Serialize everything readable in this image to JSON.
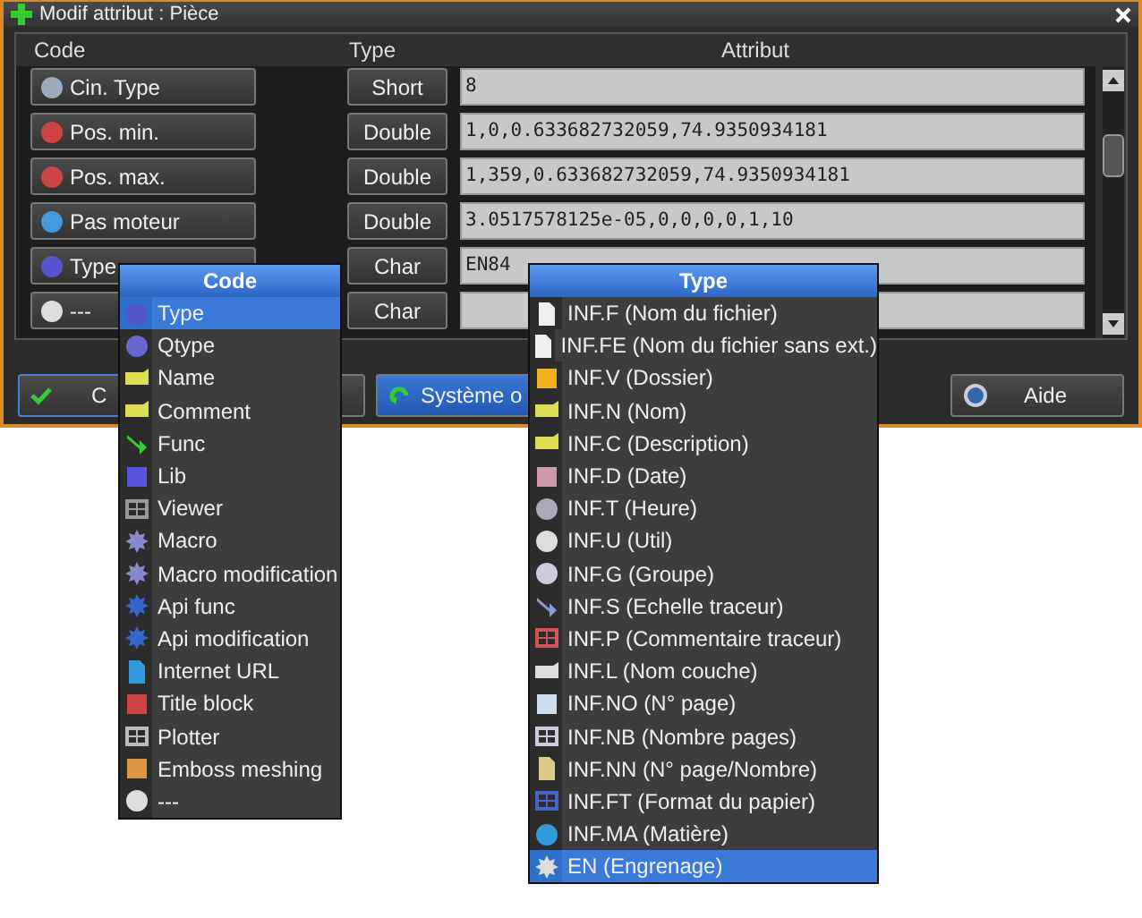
{
  "window": {
    "title": "Modif attribut : Pièce"
  },
  "table": {
    "columns": [
      "Code",
      "Type",
      "Attribut"
    ],
    "rows": [
      {
        "code": "Cin. Type",
        "type": "Short",
        "value": "8"
      },
      {
        "code": "Pos. min.",
        "type": "Double",
        "value": "1,0,0.633682732059,74.9350934181"
      },
      {
        "code": "Pos. max.",
        "type": "Double",
        "value": "1,359,0.633682732059,74.9350934181"
      },
      {
        "code": "Pas moteur",
        "type": "Double",
        "value": "3.0517578125e-05,0,0,0,0,1,10"
      },
      {
        "code": "Type",
        "type": "Char",
        "value": "EN84"
      },
      {
        "code": "---",
        "type": "Char"
      }
    ]
  },
  "buttons": [
    {
      "kind": "ok",
      "label": "C"
    },
    {
      "kind": "system",
      "label": "Système o"
    },
    {
      "kind": "help",
      "label": "Aide"
    }
  ],
  "code_menu": {
    "title": "Code",
    "items": [
      {
        "label": "Type",
        "selected": true
      },
      {
        "label": "Qtype",
        "selected": false
      },
      {
        "label": "Name",
        "selected": false
      },
      {
        "label": "Comment",
        "selected": false
      },
      {
        "label": "Func",
        "selected": false
      },
      {
        "label": "Lib",
        "selected": false
      },
      {
        "label": "Viewer",
        "selected": false
      },
      {
        "label": "Macro",
        "selected": false
      },
      {
        "label": "Macro modification",
        "selected": false
      },
      {
        "label": "Api func",
        "selected": false
      },
      {
        "label": "Api modification",
        "selected": false
      },
      {
        "label": "Internet URL",
        "selected": false
      },
      {
        "label": "Title block",
        "selected": false
      },
      {
        "label": "Plotter",
        "selected": false
      },
      {
        "label": "Emboss meshing",
        "selected": false
      },
      {
        "label": "---",
        "selected": false
      }
    ]
  },
  "type_menu": {
    "title": "Type",
    "items": [
      {
        "label": "INF.F (Nom du fichier)",
        "selected": false
      },
      {
        "label": "INF.FE (Nom du fichier sans ext.)",
        "selected": false
      },
      {
        "label": "INF.V (Dossier)",
        "selected": false
      },
      {
        "label": "INF.N (Nom)",
        "selected": false
      },
      {
        "label": "INF.C (Description)",
        "selected": false
      },
      {
        "label": "INF.D (Date)",
        "selected": false
      },
      {
        "label": "INF.T (Heure)",
        "selected": false
      },
      {
        "label": "INF.U (Util)",
        "selected": false
      },
      {
        "label": "INF.G (Groupe)",
        "selected": false
      },
      {
        "label": "INF.S (Echelle traceur)",
        "selected": false
      },
      {
        "label": "INF.P (Commentaire traceur)",
        "selected": false
      },
      {
        "label": "INF.L (Nom couche)",
        "selected": false
      },
      {
        "label": "INF.NO (N° page)",
        "selected": false
      },
      {
        "label": "INF.NB (Nombre pages)",
        "selected": false
      },
      {
        "label": "INF.NN (N° page/Nombre)",
        "selected": false
      },
      {
        "label": "INF.FT (Format du papier)",
        "selected": false
      },
      {
        "label": "INF.MA (Matière)",
        "selected": false
      },
      {
        "label": "EN (Engrenage)",
        "selected": true
      }
    ]
  }
}
